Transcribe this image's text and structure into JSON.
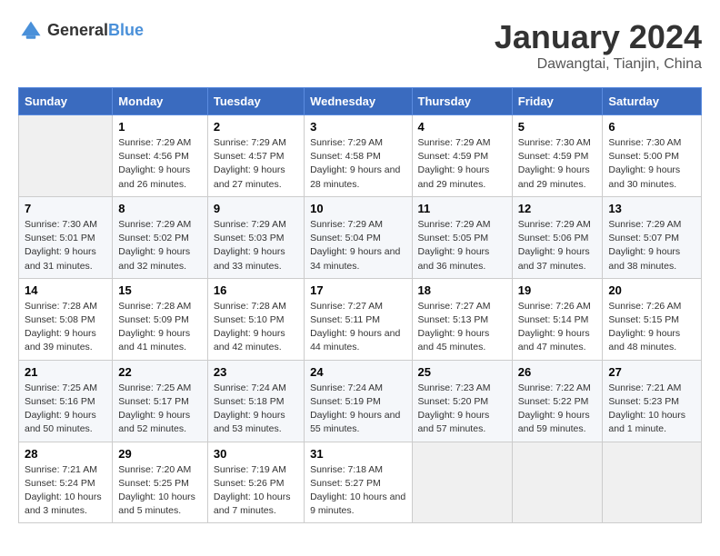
{
  "logo": {
    "line1": "General",
    "line2": "Blue"
  },
  "title": "January 2024",
  "location": "Dawangtai, Tianjin, China",
  "days_of_week": [
    "Sunday",
    "Monday",
    "Tuesday",
    "Wednesday",
    "Thursday",
    "Friday",
    "Saturday"
  ],
  "weeks": [
    {
      "cells": [
        {
          "day": null
        },
        {
          "day": 1,
          "sunrise": "7:29 AM",
          "sunset": "4:56 PM",
          "daylight": "9 hours and 26 minutes."
        },
        {
          "day": 2,
          "sunrise": "7:29 AM",
          "sunset": "4:57 PM",
          "daylight": "9 hours and 27 minutes."
        },
        {
          "day": 3,
          "sunrise": "7:29 AM",
          "sunset": "4:58 PM",
          "daylight": "9 hours and 28 minutes."
        },
        {
          "day": 4,
          "sunrise": "7:29 AM",
          "sunset": "4:59 PM",
          "daylight": "9 hours and 29 minutes."
        },
        {
          "day": 5,
          "sunrise": "7:30 AM",
          "sunset": "4:59 PM",
          "daylight": "9 hours and 29 minutes."
        },
        {
          "day": 6,
          "sunrise": "7:30 AM",
          "sunset": "5:00 PM",
          "daylight": "9 hours and 30 minutes."
        }
      ]
    },
    {
      "cells": [
        {
          "day": 7,
          "sunrise": "7:30 AM",
          "sunset": "5:01 PM",
          "daylight": "9 hours and 31 minutes."
        },
        {
          "day": 8,
          "sunrise": "7:29 AM",
          "sunset": "5:02 PM",
          "daylight": "9 hours and 32 minutes."
        },
        {
          "day": 9,
          "sunrise": "7:29 AM",
          "sunset": "5:03 PM",
          "daylight": "9 hours and 33 minutes."
        },
        {
          "day": 10,
          "sunrise": "7:29 AM",
          "sunset": "5:04 PM",
          "daylight": "9 hours and 34 minutes."
        },
        {
          "day": 11,
          "sunrise": "7:29 AM",
          "sunset": "5:05 PM",
          "daylight": "9 hours and 36 minutes."
        },
        {
          "day": 12,
          "sunrise": "7:29 AM",
          "sunset": "5:06 PM",
          "daylight": "9 hours and 37 minutes."
        },
        {
          "day": 13,
          "sunrise": "7:29 AM",
          "sunset": "5:07 PM",
          "daylight": "9 hours and 38 minutes."
        }
      ]
    },
    {
      "cells": [
        {
          "day": 14,
          "sunrise": "7:28 AM",
          "sunset": "5:08 PM",
          "daylight": "9 hours and 39 minutes."
        },
        {
          "day": 15,
          "sunrise": "7:28 AM",
          "sunset": "5:09 PM",
          "daylight": "9 hours and 41 minutes."
        },
        {
          "day": 16,
          "sunrise": "7:28 AM",
          "sunset": "5:10 PM",
          "daylight": "9 hours and 42 minutes."
        },
        {
          "day": 17,
          "sunrise": "7:27 AM",
          "sunset": "5:11 PM",
          "daylight": "9 hours and 44 minutes."
        },
        {
          "day": 18,
          "sunrise": "7:27 AM",
          "sunset": "5:13 PM",
          "daylight": "9 hours and 45 minutes."
        },
        {
          "day": 19,
          "sunrise": "7:26 AM",
          "sunset": "5:14 PM",
          "daylight": "9 hours and 47 minutes."
        },
        {
          "day": 20,
          "sunrise": "7:26 AM",
          "sunset": "5:15 PM",
          "daylight": "9 hours and 48 minutes."
        }
      ]
    },
    {
      "cells": [
        {
          "day": 21,
          "sunrise": "7:25 AM",
          "sunset": "5:16 PM",
          "daylight": "9 hours and 50 minutes."
        },
        {
          "day": 22,
          "sunrise": "7:25 AM",
          "sunset": "5:17 PM",
          "daylight": "9 hours and 52 minutes."
        },
        {
          "day": 23,
          "sunrise": "7:24 AM",
          "sunset": "5:18 PM",
          "daylight": "9 hours and 53 minutes."
        },
        {
          "day": 24,
          "sunrise": "7:24 AM",
          "sunset": "5:19 PM",
          "daylight": "9 hours and 55 minutes."
        },
        {
          "day": 25,
          "sunrise": "7:23 AM",
          "sunset": "5:20 PM",
          "daylight": "9 hours and 57 minutes."
        },
        {
          "day": 26,
          "sunrise": "7:22 AM",
          "sunset": "5:22 PM",
          "daylight": "9 hours and 59 minutes."
        },
        {
          "day": 27,
          "sunrise": "7:21 AM",
          "sunset": "5:23 PM",
          "daylight": "10 hours and 1 minute."
        }
      ]
    },
    {
      "cells": [
        {
          "day": 28,
          "sunrise": "7:21 AM",
          "sunset": "5:24 PM",
          "daylight": "10 hours and 3 minutes."
        },
        {
          "day": 29,
          "sunrise": "7:20 AM",
          "sunset": "5:25 PM",
          "daylight": "10 hours and 5 minutes."
        },
        {
          "day": 30,
          "sunrise": "7:19 AM",
          "sunset": "5:26 PM",
          "daylight": "10 hours and 7 minutes."
        },
        {
          "day": 31,
          "sunrise": "7:18 AM",
          "sunset": "5:27 PM",
          "daylight": "10 hours and 9 minutes."
        },
        {
          "day": null
        },
        {
          "day": null
        },
        {
          "day": null
        }
      ]
    }
  ],
  "labels": {
    "sunrise": "Sunrise:",
    "sunset": "Sunset:",
    "daylight": "Daylight:"
  }
}
